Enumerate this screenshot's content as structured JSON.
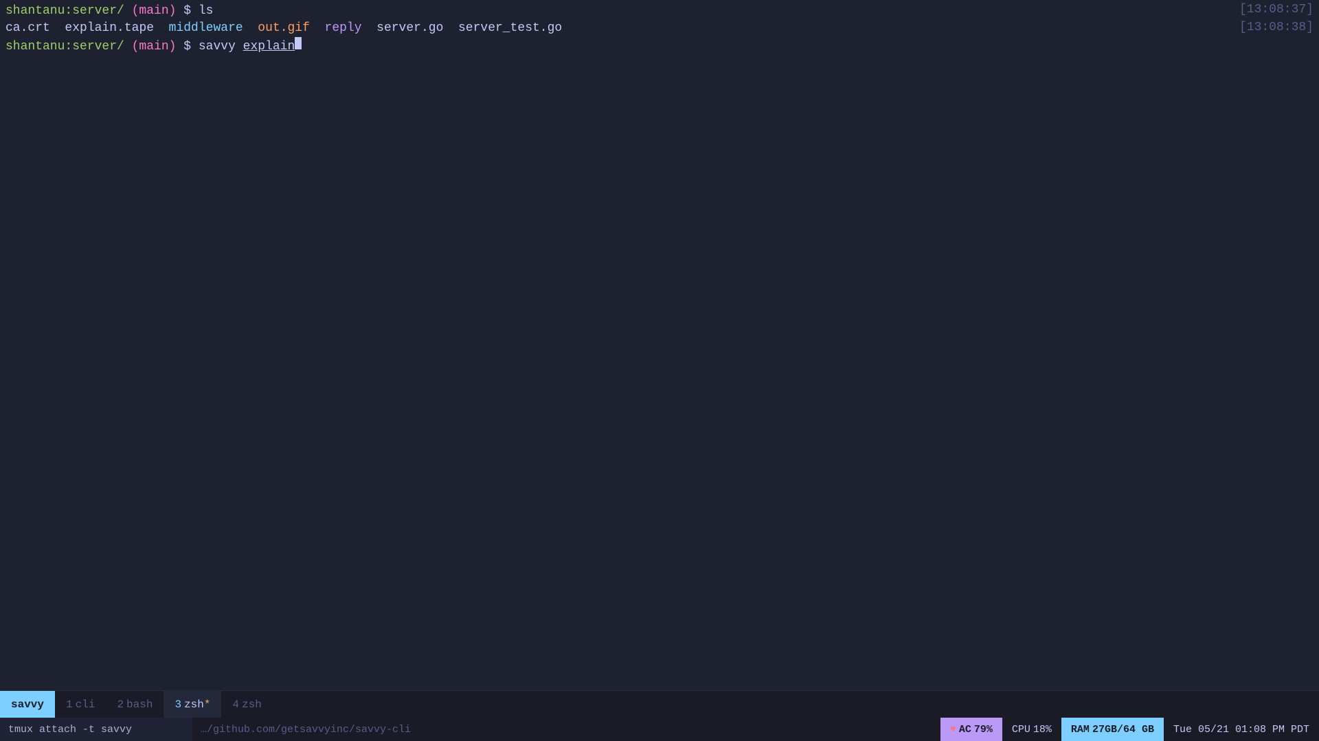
{
  "terminal": {
    "background": "#1e2130",
    "lines": [
      {
        "id": "line1",
        "prompt_user": "shantanu:server/",
        "prompt_branch": " (main)",
        "prompt_dollar": " $ ",
        "command": "ls"
      },
      {
        "id": "line2",
        "files": [
          {
            "name": "ca.crt",
            "type": "default"
          },
          {
            "name": "explain.tape",
            "type": "tape"
          },
          {
            "name": "middleware",
            "type": "dir"
          },
          {
            "name": "out.gif",
            "type": "gif"
          },
          {
            "name": "reply",
            "type": "reply"
          },
          {
            "name": "server.go",
            "type": "default"
          },
          {
            "name": "server_test.go",
            "type": "default"
          }
        ]
      },
      {
        "id": "line3",
        "prompt_user": "shantanu:server/",
        "prompt_branch": " (main)",
        "prompt_dollar": " $ ",
        "command": "savvy ",
        "arg": "explain"
      }
    ],
    "timestamps": {
      "ts1": "[13:08:37]",
      "ts2": "[13:08:38]"
    }
  },
  "tabs": {
    "session_name": "savvy",
    "items": [
      {
        "id": 1,
        "label": "cli",
        "active": false,
        "starred": false
      },
      {
        "id": 2,
        "label": "bash",
        "active": false,
        "starred": false
      },
      {
        "id": 3,
        "label": "zsh",
        "active": true,
        "starred": true
      },
      {
        "id": 4,
        "label": "zsh",
        "active": false,
        "starred": false
      }
    ]
  },
  "statusbar": {
    "command": "tmux attach -t savvy",
    "path": "…/github.com/getsavvyinc/savvy-cli",
    "battery": {
      "icon": "♥",
      "label": "AC",
      "value": "79%"
    },
    "cpu": {
      "label": "CPU",
      "value": "18%"
    },
    "ram": {
      "label": "RAM",
      "value": "27GB/64 GB"
    },
    "datetime": "Tue 05/21  01:08 PM PDT"
  }
}
